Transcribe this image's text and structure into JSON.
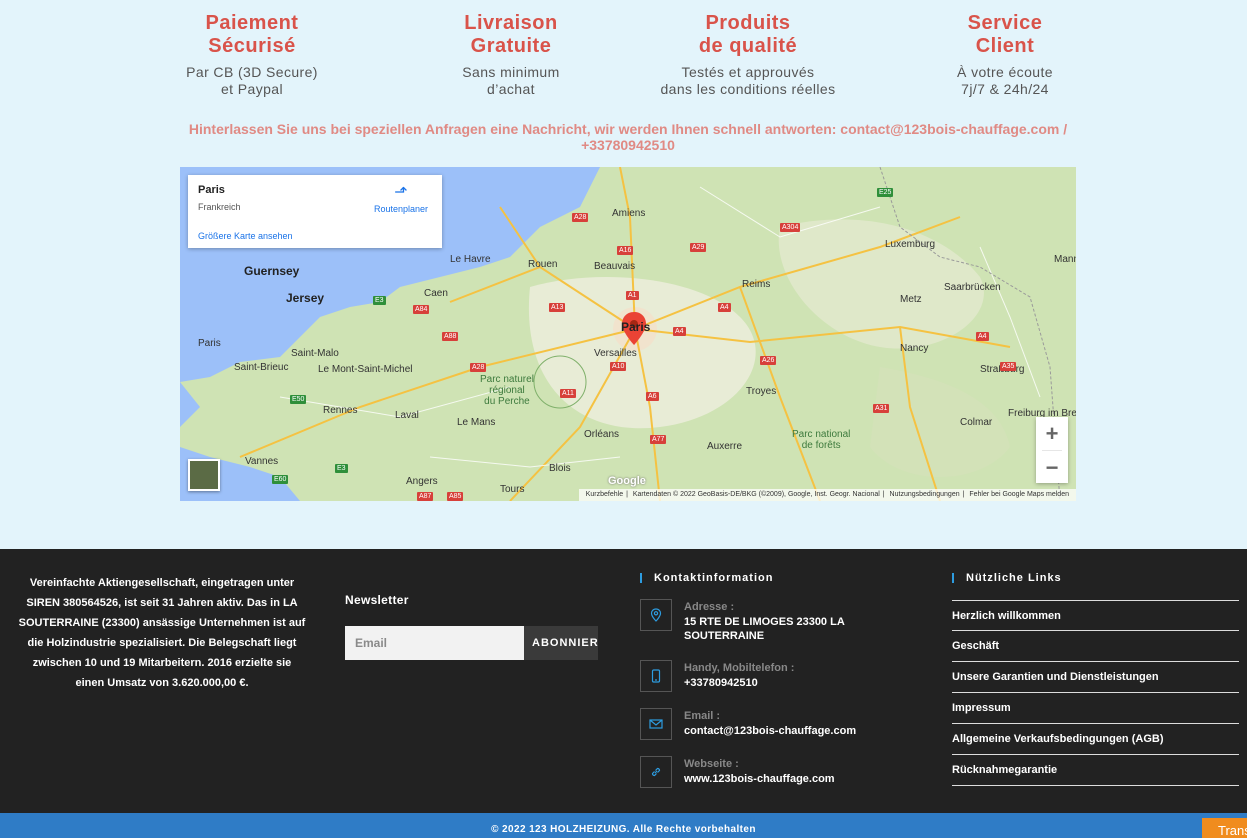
{
  "features": [
    {
      "title": "Paiement\nSécurisé",
      "desc": "Par CB (3D Secure)\net Paypal"
    },
    {
      "title": "Livraison\nGratuite",
      "desc": "Sans minimum\nd’achat"
    },
    {
      "title": "Produits\nde qualité",
      "desc": "Testés et approuvés\ndans les conditions réelles"
    },
    {
      "title": "Service\nClient",
      "desc": "À votre écoute\n7j/7 & 24h/24"
    }
  ],
  "contact_message": "Hinterlassen Sie uns bei speziellen Anfragen eine Nachricht, wir werden Ihnen schnell antworten: contact@123bois-chauffage.com / +33780942510",
  "map": {
    "place": "Paris",
    "country": "Frankreich",
    "bigger_map_link": "Größere Karte ansehen",
    "route_label": "Routenplaner",
    "zoom_in": "+",
    "zoom_out": "−",
    "attribution": [
      "Kurzbefehle",
      "Kartendaten © 2022 GeoBasis-DE/BKG (©2009), Google, Inst. Geogr. Nacional",
      "Nutzungsbedingungen",
      "Fehler bei Google Maps melden"
    ],
    "google_logo": "Google",
    "labels": {
      "guernsey": "Guernsey",
      "jersey": "Jersey",
      "paris_city": "Paris",
      "amiens": "Amiens",
      "rouen": "Rouen",
      "le_havre": "Le Havre",
      "caen": "Caen",
      "beauvais": "Beauvais",
      "reims": "Reims",
      "versailles": "Versailles",
      "metz": "Metz",
      "nancy": "Nancy",
      "strasbourg": "Straßburg",
      "luxemburg": "Luxemburg",
      "saarbruecken": "Saarbrücken",
      "troyes": "Troyes",
      "orleans": "Orléans",
      "auxerre": "Auxerre",
      "blois": "Blois",
      "tours": "Tours",
      "angers": "Angers",
      "le_mans": "Le Mans",
      "laval": "Laval",
      "rennes": "Rennes",
      "vannes": "Vannes",
      "saint_malo": "Saint-Malo",
      "saint_brieuc": "Saint-Brieuc",
      "paris_west": "Paris",
      "le_mont": "Le Mont-Saint-Michel",
      "colmar": "Colmar",
      "freiburg": "Freiburg im Breis",
      "mann": "Mann",
      "park_perche": "Parc naturel\nrégional\ndu Perche",
      "park_forets": "Parc national\nde forêts"
    },
    "roads": [
      "A28",
      "A16",
      "A29",
      "A1",
      "A304",
      "A13",
      "A84",
      "A88",
      "A28",
      "A4",
      "A4",
      "A26",
      "A10",
      "A11",
      "A6",
      "A77",
      "A85",
      "A87",
      "A31",
      "A4",
      "A35",
      "E25",
      "E50",
      "E3",
      "E60",
      "E3"
    ]
  },
  "footer": {
    "about": "Vereinfachte Aktiengesellschaft, eingetragen unter SIREN 380564526, ist seit 31 Jahren aktiv. Das in LA SOUTERRAINE (23300) ansässige Unternehmen ist auf die Holzindustrie spezialisiert. Die Belegschaft liegt zwischen 10 und 19 Mitarbeitern. 2016 erzielte sie einen Umsatz von 3.620.000,00 €.",
    "newsletter_title": "Newsletter",
    "email_placeholder": "Email",
    "subscribe_label": "ABONNIEREN",
    "contact_heading": "Kontaktinformation",
    "contacts": [
      {
        "label": "Adresse :",
        "value": "15 RTE DE LIMOGES 23300 LA SOUTERRAINE",
        "icon": "location-pin-icon"
      },
      {
        "label": "Handy, Mobiltelefon :",
        "value": "+33780942510",
        "icon": "mobile-phone-icon"
      },
      {
        "label": "Email :",
        "value": "contact@123bois-chauffage.com",
        "icon": "envelope-icon"
      },
      {
        "label": "Webseite :",
        "value": "www.123bois-chauffage.com",
        "icon": "link-icon"
      }
    ],
    "links_heading": "Nützliche Links",
    "links": [
      "Herzlich willkommen",
      "Geschäft",
      "Unsere Garantien und Dienstleistungen",
      "Impressum",
      "Allgemeine Verkaufsbedingungen (AGB)",
      "Rücknahmegarantie"
    ]
  },
  "copyright": "© 2022 123 HOLZHEIZUNG. Alle Rechte vorbehalten",
  "translate_label": "Translate",
  "colors": {
    "accent_red": "#d9534a",
    "footer_bg": "#222222",
    "copyright_bg": "#2f7cc6",
    "link_blue": "#2d9ce0",
    "translate_orange": "#f08c1e"
  }
}
